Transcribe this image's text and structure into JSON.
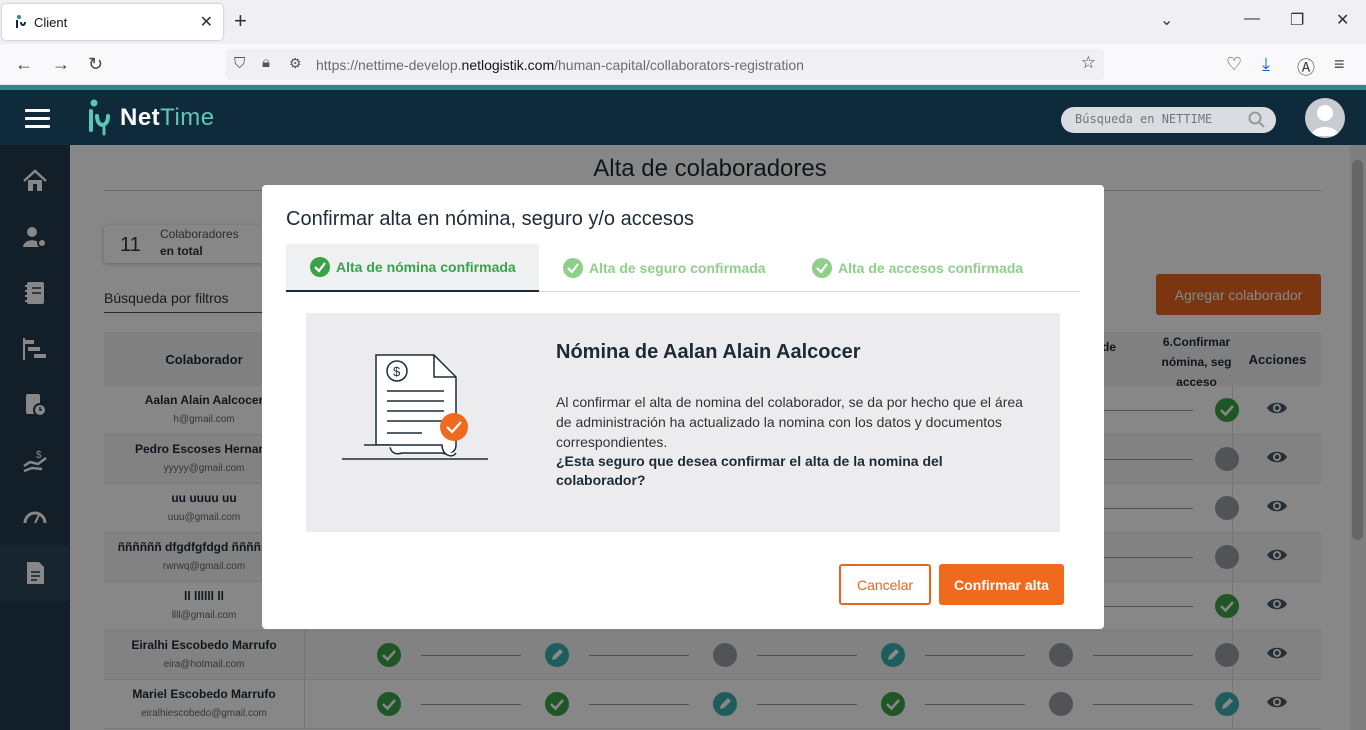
{
  "browser": {
    "tab_title": "Client",
    "url_prefix": "https://nettime-develop.",
    "url_domain": "netlogistik.com",
    "url_path": "/human-capital/collaborators-registration"
  },
  "app": {
    "brand_net": "Net",
    "brand_time": "Time",
    "search_placeholder": "Búsqueda en NETTIME"
  },
  "sidebar": {
    "items": [
      {
        "icon": "home-icon"
      },
      {
        "icon": "user-settings-icon"
      },
      {
        "icon": "notebook-icon"
      },
      {
        "icon": "gantt-icon"
      },
      {
        "icon": "document-clock-icon"
      },
      {
        "icon": "hand-money-icon"
      },
      {
        "icon": "speedometer-icon"
      },
      {
        "icon": "document-icon"
      }
    ]
  },
  "page": {
    "title": "Alta de colaboradores",
    "count": "11",
    "count_label_1": "Colaboradores",
    "count_label_2": "en total",
    "filter_label": "Búsqueda por filtros",
    "add_button": "Agregar colaborador",
    "table": {
      "col_collaborator": "Colaborador",
      "col_partial_de": "de",
      "col_confirm": "6.Confirmar nómina, seg acceso",
      "col_actions": "Acciones",
      "rows": [
        {
          "name": "Aalan Alain Aalcocer",
          "email": "h@gmail.com"
        },
        {
          "name": "Pedro Escoses Hernand",
          "email": "yyyyy@gmail.com"
        },
        {
          "name": "uu uuuu uu",
          "email": "uuu@gmail.com"
        },
        {
          "name": "ññññññ dfgdfgfdgd ññññññññ",
          "email": "rwrwq@gmail.com"
        },
        {
          "name": "ll llllll ll",
          "email": "llll@gmail.com"
        },
        {
          "name": "Eiralhi Escobedo Marrufo",
          "email": "eira@hotmail.com"
        },
        {
          "name": "Mariel Escobedo Marrufo",
          "email": "eiralhiescobedo@gmail.com"
        }
      ]
    }
  },
  "modal": {
    "title": "Confirmar alta en nómina, seguro y/o accesos",
    "tabs": [
      {
        "label": "Alta de nómina confirmada"
      },
      {
        "label": "Alta de seguro confirmada"
      },
      {
        "label": "Alta de accesos confirmada"
      }
    ],
    "body_title": "Nómina de Aalan Alain Aalcocer",
    "body_text": "Al confirmar el alta de nomina del colaborador, se da por hecho que el área de administración ha actualizado la nomina con los datos y documentos correspondientes.",
    "body_question": "¿Esta seguro que desea confirmar el alta de la nomina del colaborador?",
    "cancel": "Cancelar",
    "confirm": "Confirmar alta"
  },
  "colors": {
    "header_bg": "#0f2a3b",
    "accent_orange": "#f06a1e",
    "success_green": "#3aa349",
    "teal": "#3aaeb0"
  }
}
